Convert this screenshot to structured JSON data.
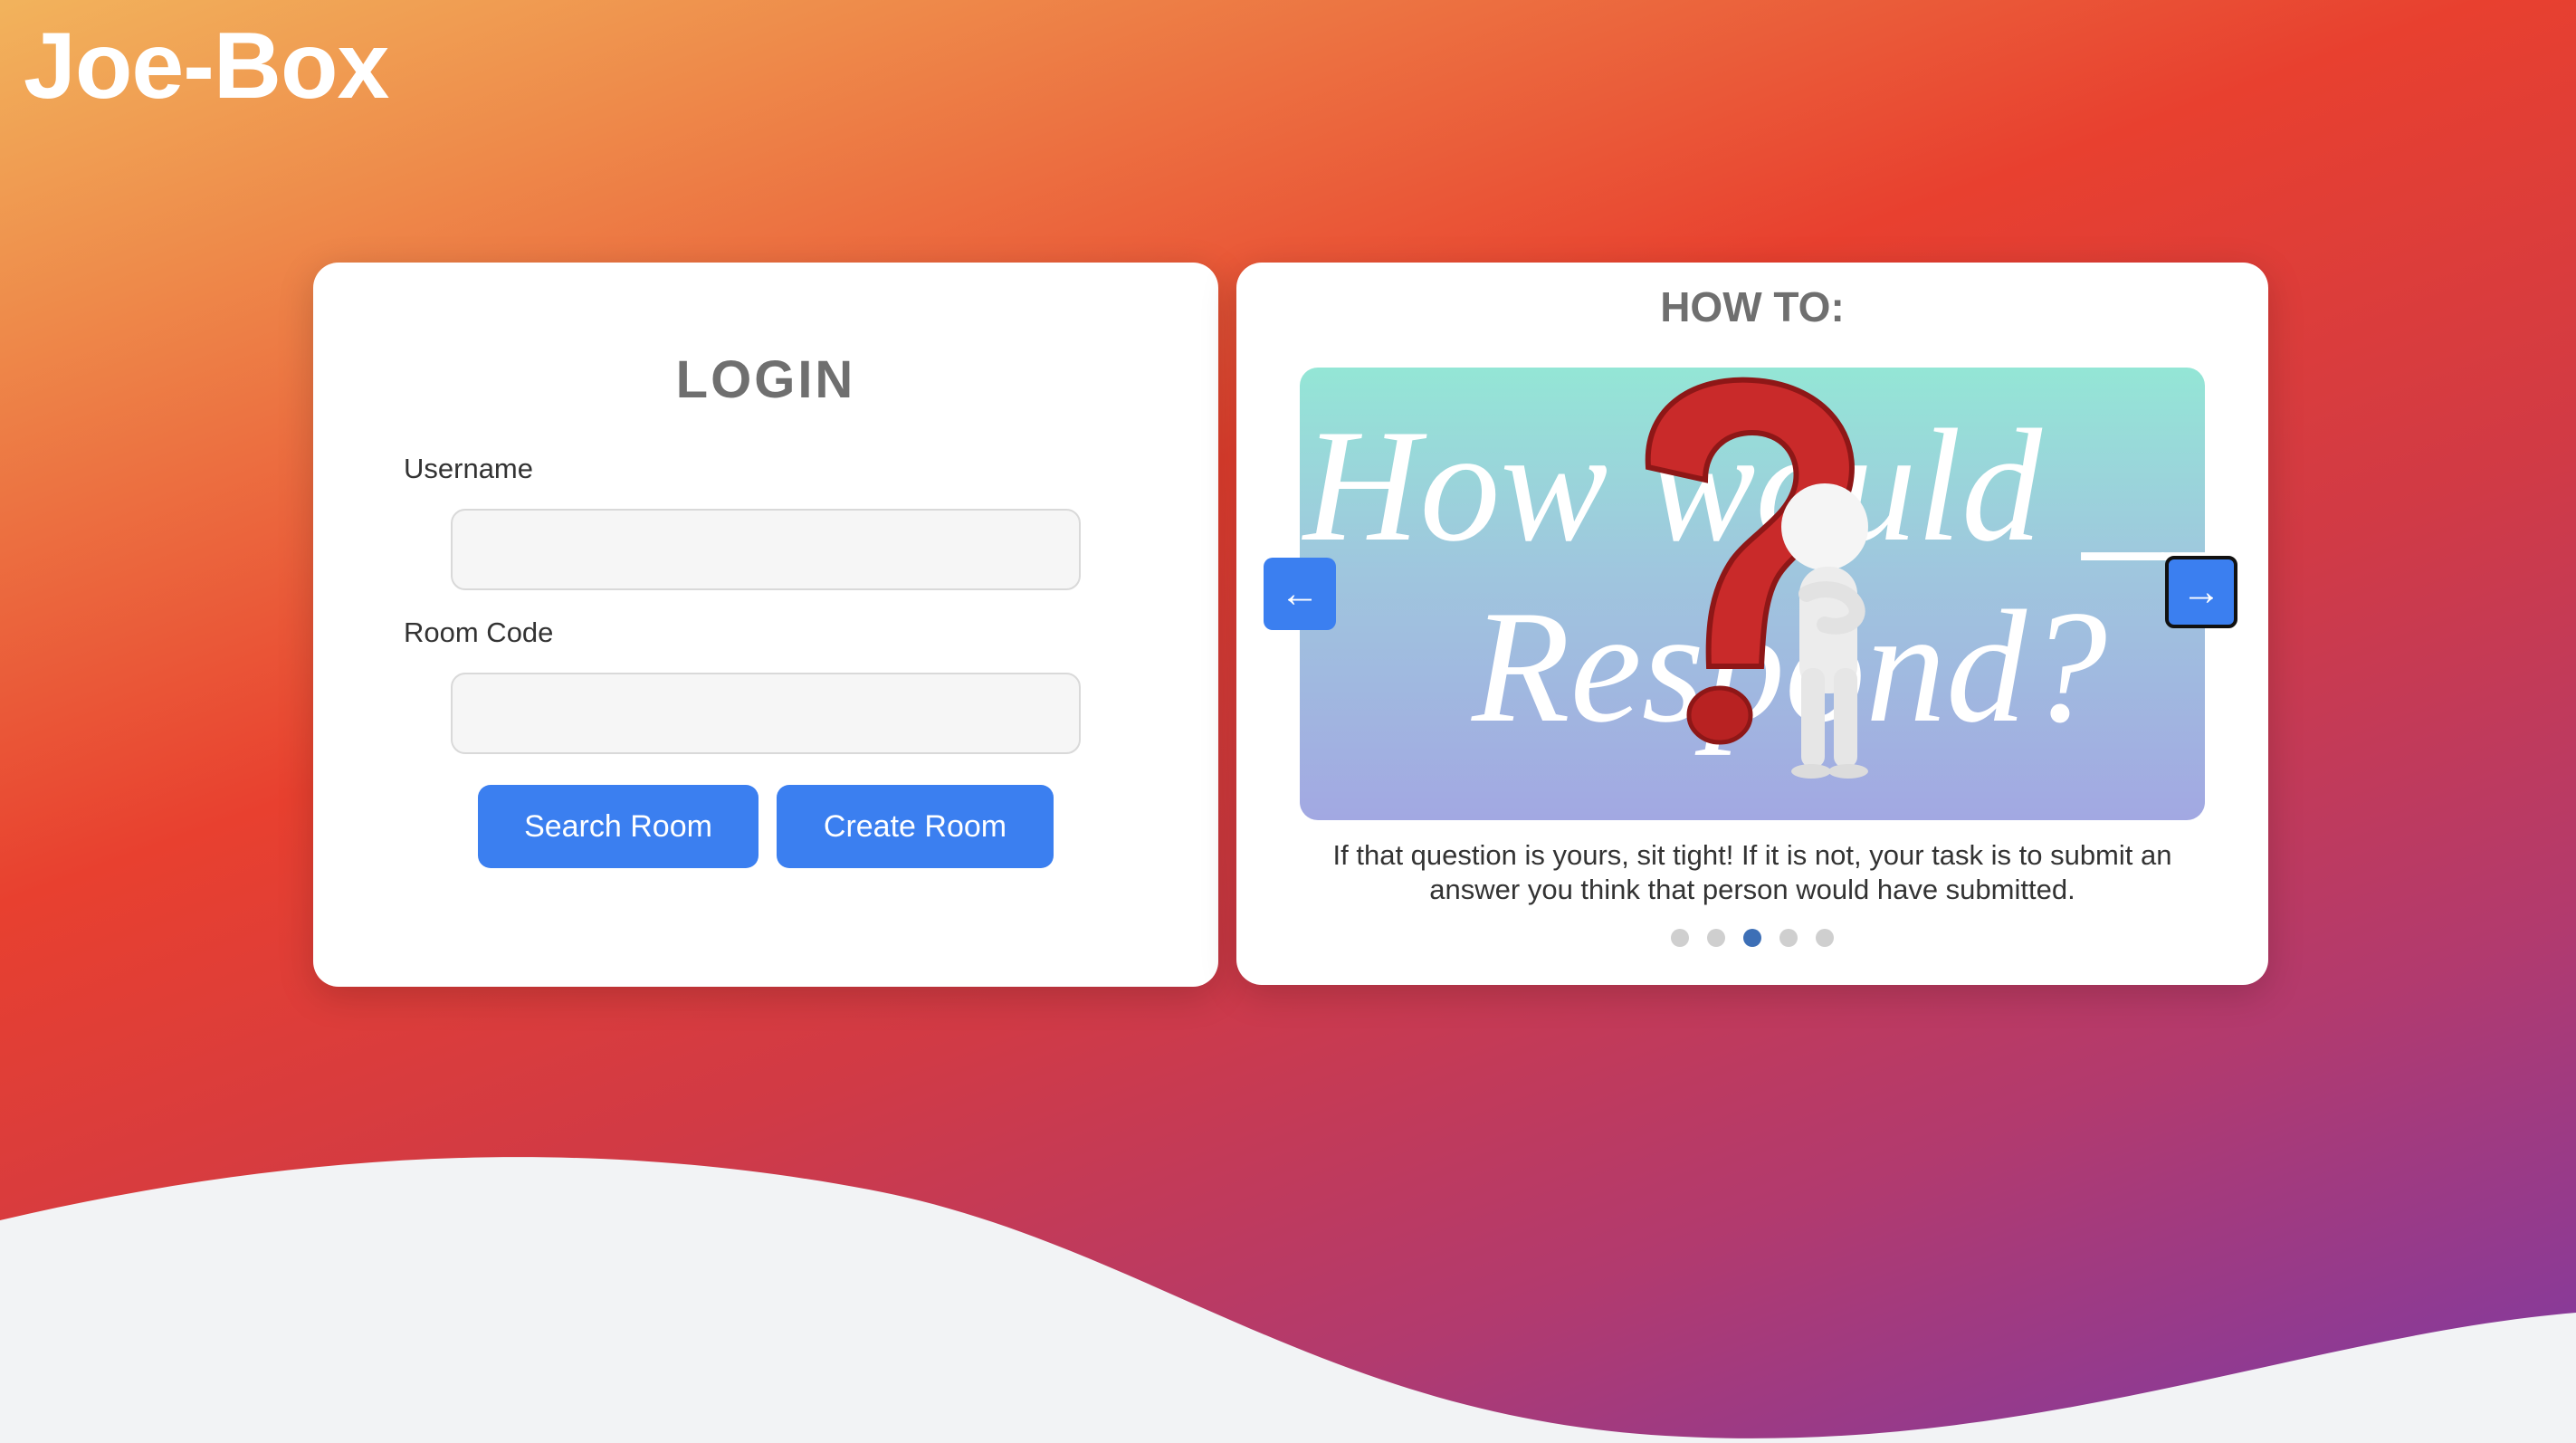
{
  "app": {
    "brand": "Joe-Box"
  },
  "login": {
    "title": "LOGIN",
    "username_label": "Username",
    "username_value": "",
    "room_code_label": "Room Code",
    "room_code_value": "",
    "search_button": "Search Room",
    "create_button": "Create Room"
  },
  "howto": {
    "title": "HOW TO:",
    "slide_text_line1": "How would ___",
    "slide_text_line2": "Respond?",
    "prev_arrow": "←",
    "next_arrow": "→",
    "caption": "If that question is yours, sit tight! If it is not, your task is to submit an answer you think that person would have submitted.",
    "dots_total": 5,
    "active_dot": 3
  },
  "colors": {
    "accent": "#3b7ff0",
    "active_dot": "#3d6fb6",
    "inactive_dot": "#cfcfcf",
    "wave": "#f2f3f5"
  },
  "icons": {
    "prev": "arrow-left-icon",
    "next": "arrow-right-icon"
  }
}
